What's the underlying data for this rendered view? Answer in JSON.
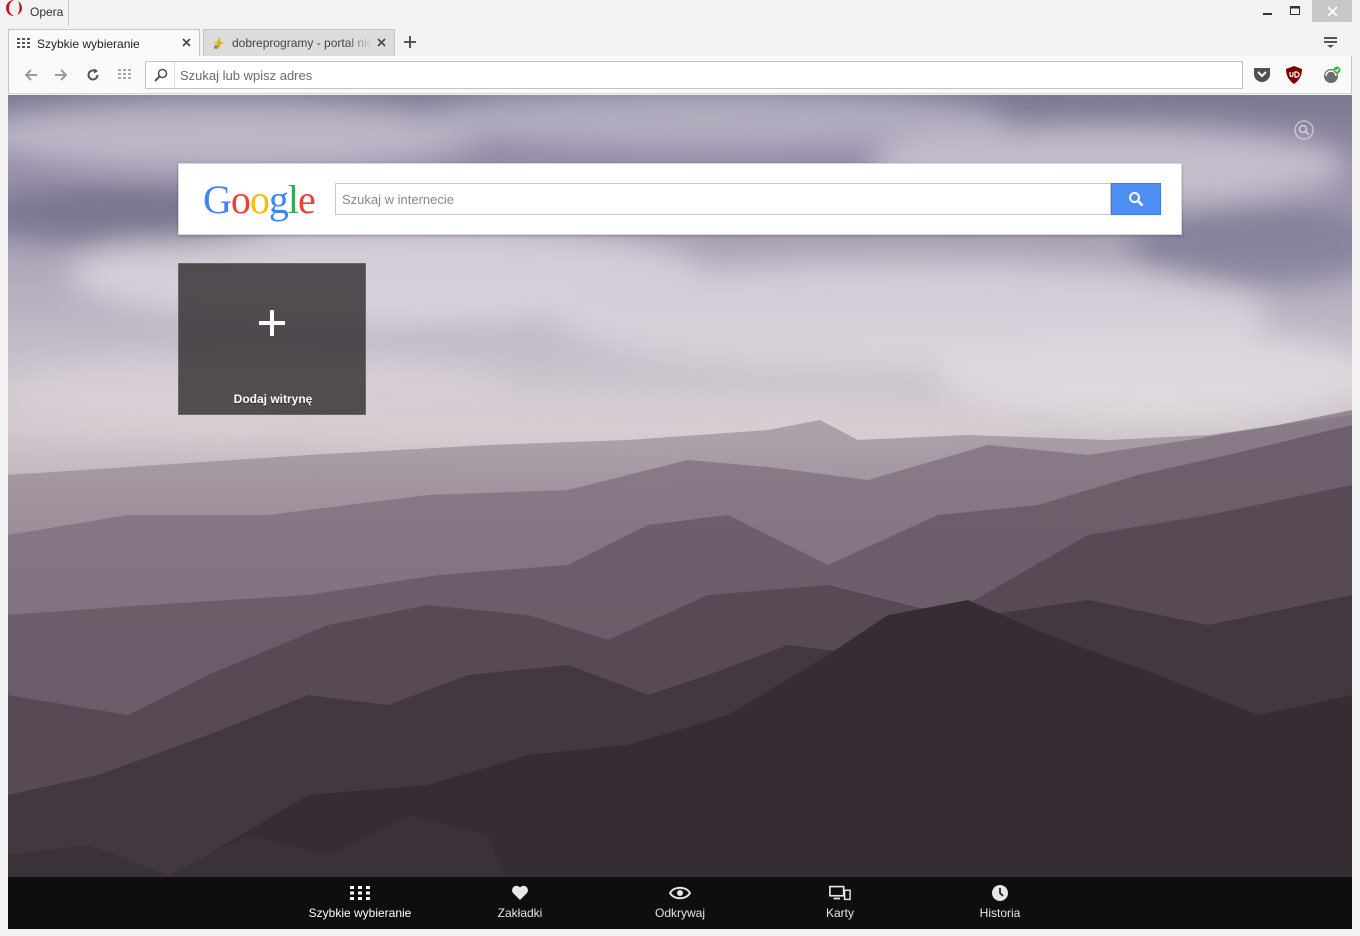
{
  "window": {
    "app_title": "Opera",
    "controls": [
      "minimize-icon",
      "maximize-icon",
      "close-icon"
    ]
  },
  "tabs": [
    {
      "label": "Szybkie wybieranie",
      "icon": "speed-dial-icon",
      "active": true
    },
    {
      "label": "dobreprogramy - portal nie",
      "icon": "dobreprogramy-favicon",
      "active": false
    }
  ],
  "toolbar": {
    "address_placeholder": "Szukaj lub wpisz adres",
    "extensions": [
      "pocket-icon",
      "ublock-icon",
      "vpn-status-icon"
    ]
  },
  "search": {
    "logo": "Google",
    "placeholder": "Szukaj w internecie"
  },
  "speed_dial": {
    "add_label": "Dodaj witrynę"
  },
  "bottom_nav": [
    {
      "label": "Szybkie wybieranie",
      "icon": "grid-icon",
      "active": true
    },
    {
      "label": "Zakładki",
      "icon": "heart-icon",
      "active": false
    },
    {
      "label": "Odkrywaj",
      "icon": "eye-icon",
      "active": false
    },
    {
      "label": "Karty",
      "icon": "devices-icon",
      "active": false
    },
    {
      "label": "Historia",
      "icon": "clock-icon",
      "active": false
    }
  ],
  "colors": {
    "google_blue": "#4285F4",
    "google_red": "#EA4335",
    "google_yellow": "#FBBC05",
    "google_green": "#34A853",
    "search_button": "#4d8ff3",
    "opera_red": "#cc0f16"
  }
}
